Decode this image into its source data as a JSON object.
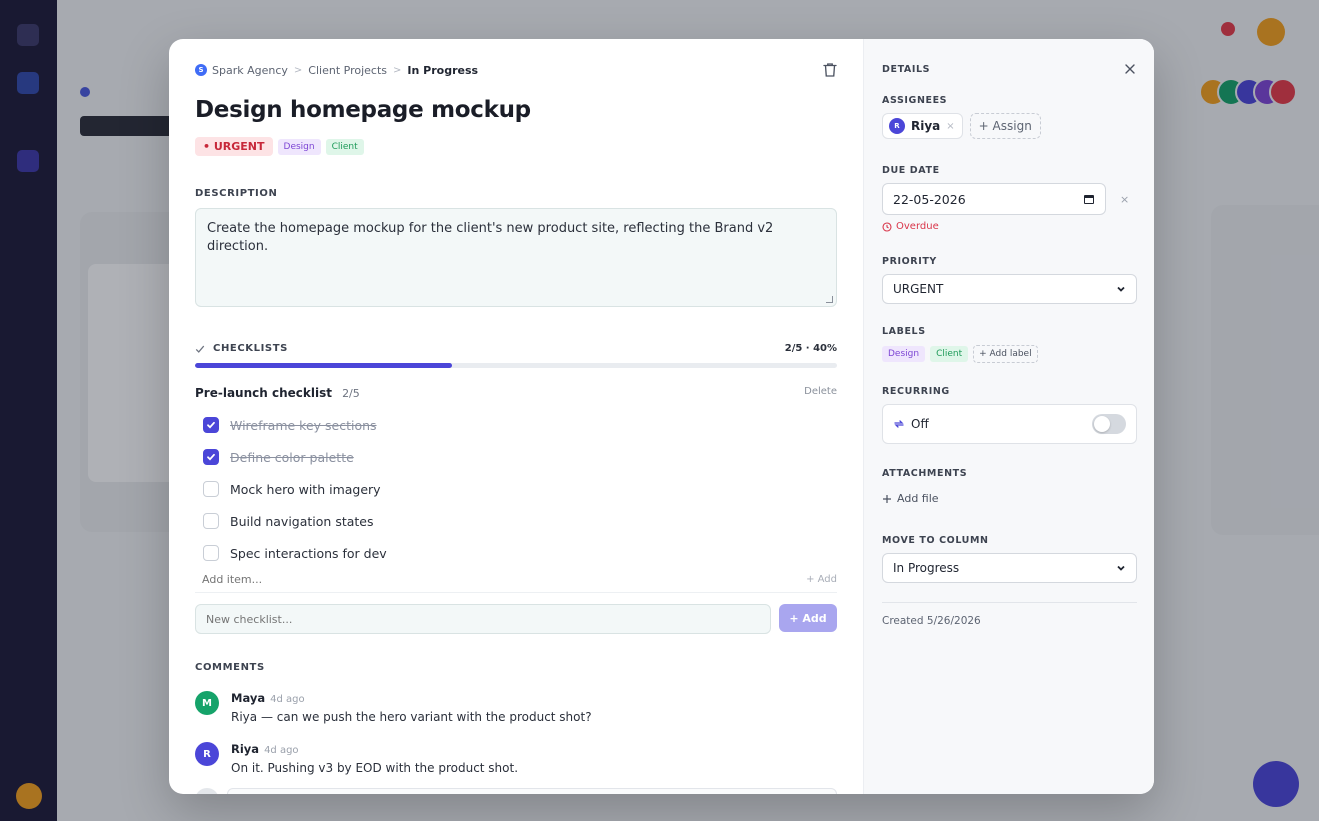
{
  "breadcrumb": {
    "workspace_initial": "S",
    "workspace": "Spark Agency",
    "project": "Client Projects",
    "column": "In Progress",
    "separator": ">"
  },
  "task": {
    "title": "Design homepage mockup",
    "priority_tag": "• URGENT",
    "labels": [
      "Design",
      "Client"
    ]
  },
  "description": {
    "label": "DESCRIPTION",
    "text": "Create the homepage mockup for the client's new product site, reflecting the Brand v2 direction."
  },
  "checklists": {
    "label": "CHECKLISTS",
    "progress_text": "2/5 · 40%",
    "progress_fraction": 0.4,
    "list": {
      "name": "Pre-launch checklist",
      "count": "2/5",
      "delete_label": "Delete",
      "items": [
        {
          "text": "Wireframe key sections",
          "done": true
        },
        {
          "text": "Define color palette",
          "done": true
        },
        {
          "text": "Mock hero with imagery",
          "done": false
        },
        {
          "text": "Build navigation states",
          "done": false
        },
        {
          "text": "Spec interactions for dev",
          "done": false
        }
      ],
      "add_item_placeholder": "Add item...",
      "add_item_button": "+ Add"
    },
    "new_checklist_placeholder": "New checklist...",
    "new_checklist_button": "+ Add"
  },
  "comments": {
    "label": "COMMENTS",
    "items": [
      {
        "initial": "M",
        "author": "Maya",
        "time": "4d ago",
        "body": "Riya — can we push the hero variant with the product shot?",
        "color": "#16a36a"
      },
      {
        "initial": "R",
        "author": "Riya",
        "time": "4d ago",
        "body": "On it. Pushing v3 by EOD with the product shot.",
        "color": "#4b46d8"
      }
    ]
  },
  "details": {
    "label": "DETAILS",
    "assignees": {
      "label": "ASSIGNEES",
      "people": [
        {
          "initial": "R",
          "name": "Riya"
        }
      ],
      "remove_glyph": "×",
      "assign_button": "+ Assign"
    },
    "due_date": {
      "label": "DUE DATE",
      "value": "22-05-2026",
      "clear_glyph": "×",
      "status": "Overdue"
    },
    "priority": {
      "label": "PRIORITY",
      "value": "URGENT"
    },
    "labels": {
      "label": "LABELS",
      "items": [
        "Design",
        "Client"
      ],
      "add_button": "+ Add label"
    },
    "recurring": {
      "label": "RECURRING",
      "value": "Off",
      "enabled": false
    },
    "attachments": {
      "label": "ATTACHMENTS",
      "add_button": "Add file"
    },
    "move_to_column": {
      "label": "MOVE TO COLUMN",
      "value": "In Progress"
    },
    "created": "Created 5/26/2026"
  },
  "colors": {
    "accent": "#4b46d8",
    "urgent": "#c7283a",
    "overdue": "#d9364a",
    "label_design": "#7d46d4",
    "label_client": "#1f9b5a"
  },
  "icons": {
    "trash": "trash-icon",
    "close": "close-icon",
    "check": "check-icon",
    "calendar": "calendar-icon",
    "clock": "clock-icon",
    "repeat": "repeat-icon",
    "plus": "plus-icon",
    "chevron": "chevron-down-icon"
  }
}
